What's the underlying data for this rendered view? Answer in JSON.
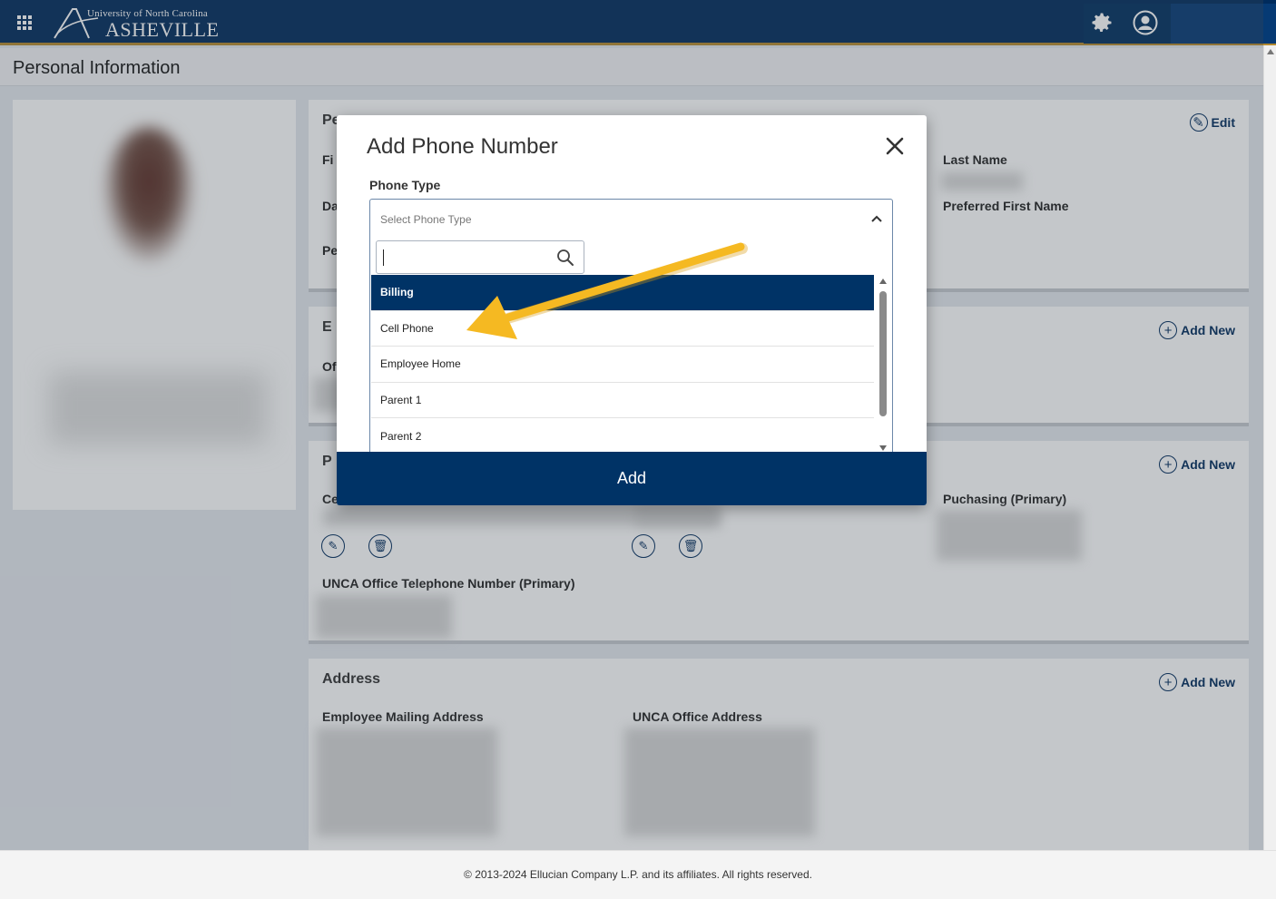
{
  "header": {
    "logo_university": "University of North Carolina",
    "logo_campus": "ASHEVILLE"
  },
  "page": {
    "title": "Personal Information"
  },
  "sections": {
    "personal": {
      "title_partial": "Pe",
      "edit_label": "Edit",
      "fields": {
        "first_partial": "Fi",
        "date_partial": "Da",
        "pref_partial": "Pe",
        "last_name": "Last Name",
        "preferred_first_name": "Preferred First Name"
      }
    },
    "email": {
      "title_partial": "E",
      "add_new_label": "Add New",
      "field_partial": "Of"
    },
    "phone": {
      "title_partial": "P",
      "add_new_label": "Add New",
      "field_cell_partial": "Ce",
      "purchasing": "Puchasing (Primary)",
      "office": "UNCA Office Telephone Number (Primary)"
    },
    "address": {
      "title": "Address",
      "add_new_label": "Add New",
      "mailing": "Employee Mailing Address",
      "office": "UNCA Office Address"
    }
  },
  "modal": {
    "title": "Add Phone Number",
    "phone_type_label": "Phone Type",
    "select_placeholder": "Select Phone Type",
    "search_value": "",
    "options": [
      "Billing",
      "Cell Phone",
      "Employee Home",
      "Parent 1",
      "Parent 2"
    ],
    "selected_option": "Billing",
    "add_button": "Add"
  },
  "footer": {
    "copyright": "© 2013-2024 Ellucian Company L.P. and its affiliates. All rights reserved."
  },
  "colors": {
    "navy": "#002b5c",
    "gold": "#b58a2f",
    "annotation_arrow": "#f5b922",
    "selected_option_bg": "#003366"
  },
  "icons": [
    "apps-grid-icon",
    "gear-icon",
    "user-icon",
    "close-icon",
    "chevron-up-icon",
    "search-icon",
    "edit-icon",
    "add-circle-icon",
    "pencil-icon",
    "trash-icon"
  ]
}
